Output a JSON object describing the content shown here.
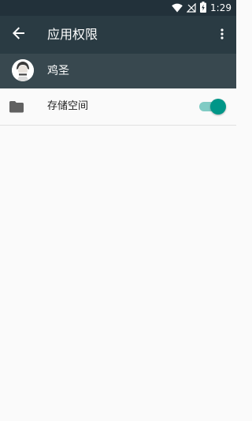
{
  "status_bar": {
    "time": "1:29",
    "icons": [
      "wifi-icon",
      "no-signal-icon",
      "battery-charging-icon"
    ]
  },
  "toolbar": {
    "back_icon": "arrow-back-icon",
    "title": "应用权限",
    "overflow_icon": "more-vert-icon"
  },
  "app": {
    "name": "鸡圣",
    "avatar_icon": "app-avatar-icon"
  },
  "permissions": [
    {
      "icon": "folder-icon",
      "label": "存储空间",
      "enabled": true
    }
  ],
  "colors": {
    "status_bar": "#22313a",
    "toolbar": "#2a3b43",
    "app_header": "#38484f",
    "background": "#fafafa",
    "toggle_thumb": "#009688",
    "toggle_track": "#80cbc4"
  }
}
